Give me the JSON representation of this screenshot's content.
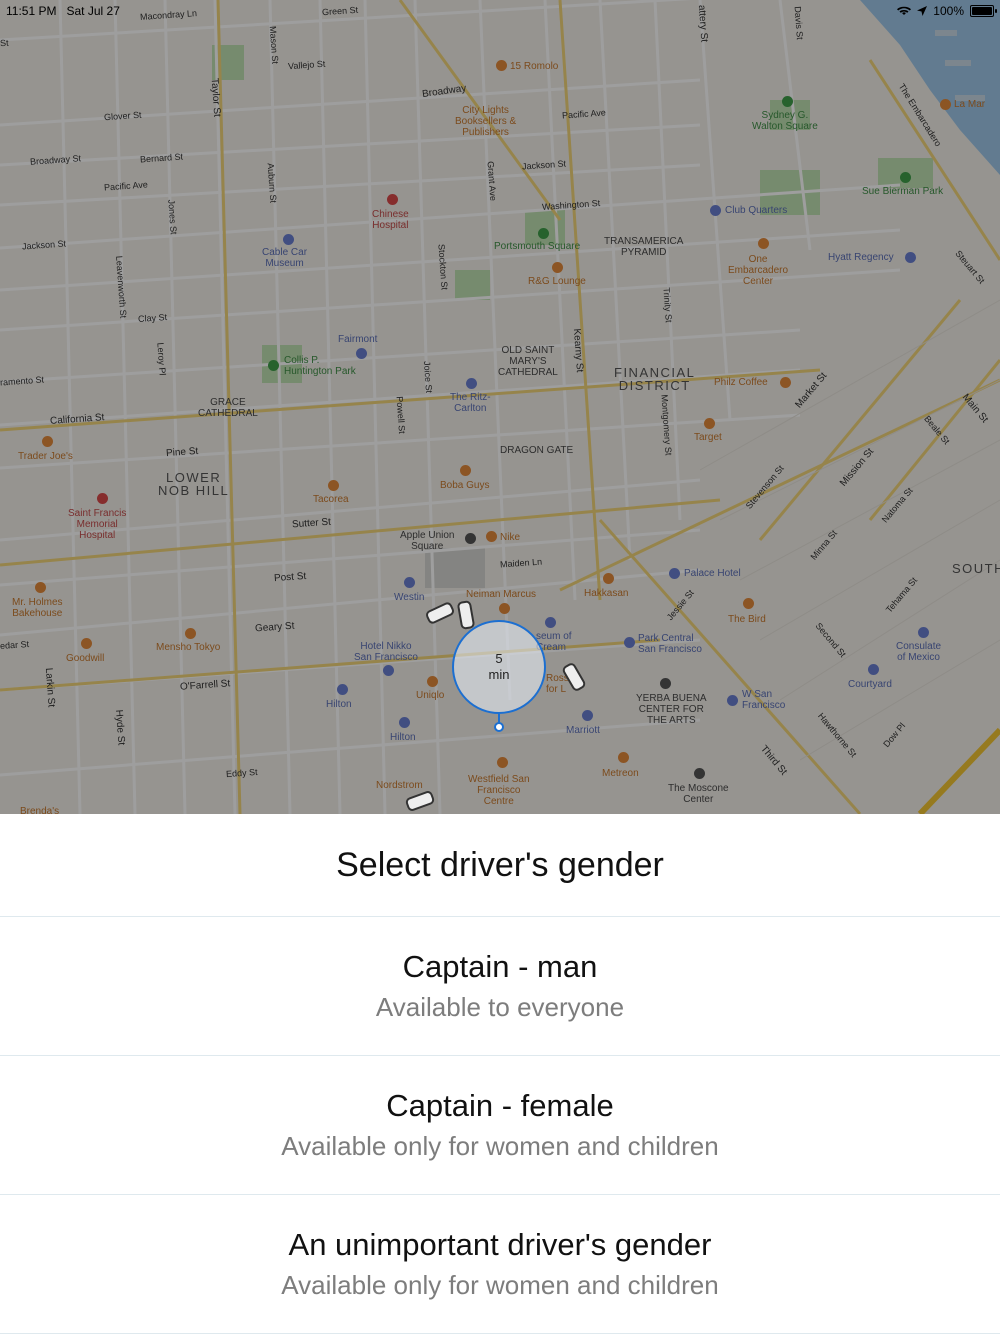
{
  "status_bar": {
    "time": "11:51 PM",
    "date": "Sat Jul 27",
    "battery": "100%"
  },
  "map": {
    "eta_value": "5",
    "eta_unit": "min",
    "pois": {
      "romolo": "15 Romolo",
      "city_lights": "City Lights\nBooksellers &\nPublishers",
      "sydney": "Sydney G.\nWalton Square",
      "la_mar": "La Mar",
      "sue_bierman": "Sue Bierman Park",
      "chinese_hospital": "Chinese\nHospital",
      "club_quarters": "Club Quarters",
      "cable_car": "Cable Car\nMuseum",
      "portsmouth": "Portsmouth Square",
      "transamerica": "TRANSAMERICA\nPYRAMID",
      "one_embarcadero": "One\nEmbarcadero\nCenter",
      "hyatt": "Hyatt Regency",
      "rg_lounge": "R&G Lounge",
      "fairmont": "Fairmont",
      "old_saint_marys": "OLD SAINT\nMARY'S\nCATHEDRAL",
      "collis": "Collis P.\nHuntington Park",
      "financial_district": "FINANCIAL\nDISTRICT",
      "philz": "Philz Coffee",
      "grace": "GRACE\nCATHEDRAL",
      "ritz": "The Ritz-\nCarlton",
      "target": "Target",
      "dragon_gate": "DRAGON GATE",
      "trader_joes": "Trader Joe's",
      "lower_nob_hill": "LOWER\nNOB HILL",
      "boba_guys": "Boba Guys",
      "saint_francis": "Saint Francis\nMemorial\nHospital",
      "tacorea": "Tacorea",
      "apple": "Apple Union\nSquare",
      "nike": "Nike",
      "mr_holmes": "Mr. Holmes\nBakehouse",
      "westin": "Westin",
      "neiman": "Neiman Marcus",
      "hakkasan": "Hakkasan",
      "palace": "Palace Hotel",
      "the_bird": "The Bird",
      "south": "SOUTH",
      "museum_ice_cream": "seum of\nCream",
      "park_central": "Park Central\nSan Francisco",
      "consulate": "Consulate\nof Mexico",
      "goodwill": "Goodwill",
      "mensho": "Mensho Tokyo",
      "hotel_nikko": "Hotel Nikko\nSan Francisco",
      "ross": "Ross\nfor L",
      "courtyard": "Courtyard",
      "hilton1": "Hilton",
      "uniqlo": "Uniqlo",
      "yerba": "YERBA BUENA\nCENTER FOR\nTHE ARTS",
      "w_sf": "W San\nFrancisco",
      "marriott": "Marriott",
      "hilton2": "Hilton",
      "metreon": "Metreon",
      "westfield": "Westfield San\nFrancisco\nCentre",
      "nordstrom": "Nordstrom",
      "moscone": "The Moscone\nCenter",
      "brendas": "Brenda's"
    },
    "streets": {
      "macondray": "Macondray Ln",
      "green": "Green St",
      "vallejo": "Vallejo St",
      "broadway1": "Broadway",
      "broadway2": "Broadway St",
      "glover": "Glover St",
      "bernard": "Bernard St",
      "pacific": "Pacific Ave",
      "pacific2": "Pacific Ave",
      "jackson": "Jackson St",
      "jackson2": "Jackson St",
      "washington": "Washington St",
      "clay": "Clay St",
      "california": "California St",
      "pine": "Pine St",
      "sutter": "Sutter St",
      "post": "Post St",
      "geary": "Geary St",
      "ofarrell": "O'Farrell St",
      "eddy": "Eddy St",
      "maiden": "Maiden Ln",
      "taylor": "Taylor St",
      "mason": "Mason St",
      "kearny": "Kearny St",
      "stockton": "Stockton St",
      "powell": "Powell St",
      "larkin": "Larkin St",
      "hyde": "Hyde St",
      "market": "Market St",
      "mission": "Mission St",
      "third": "Third St",
      "main": "Main St",
      "embarcadero": "The Embarcadero",
      "battery": "attery St",
      "davis": "Davis St",
      "steuart": "Steuart St",
      "sacramento": "ramento St",
      "jones": "Jones St",
      "leavenworth": "Leavenworth St",
      "grant": "Grant Ave",
      "leroy": "Leroy Pl",
      "joice": "Joice St",
      "montgomery": "Montgomery St",
      "trinity": "Trinity St",
      "auburn": "Auburn St",
      "beale": "Beale St",
      "natoma": "Natoma St",
      "minna": "Minna St",
      "tehama": "Tehama St",
      "jessie": "Jessie St",
      "stevenson": "Stevenson St",
      "second": "Second St",
      "hawthorne": "Hawthorne St",
      "dow": "Dow Pl",
      "cedar": "edar St",
      "st": "St"
    }
  },
  "sheet": {
    "title": "Select driver's gender",
    "options": [
      {
        "title": "Captain - man",
        "subtitle": "Available to everyone"
      },
      {
        "title": "Captain - female",
        "subtitle": "Available only for women and children"
      },
      {
        "title": "An unimportant driver's gender",
        "subtitle": "Available only for women and children"
      }
    ]
  }
}
